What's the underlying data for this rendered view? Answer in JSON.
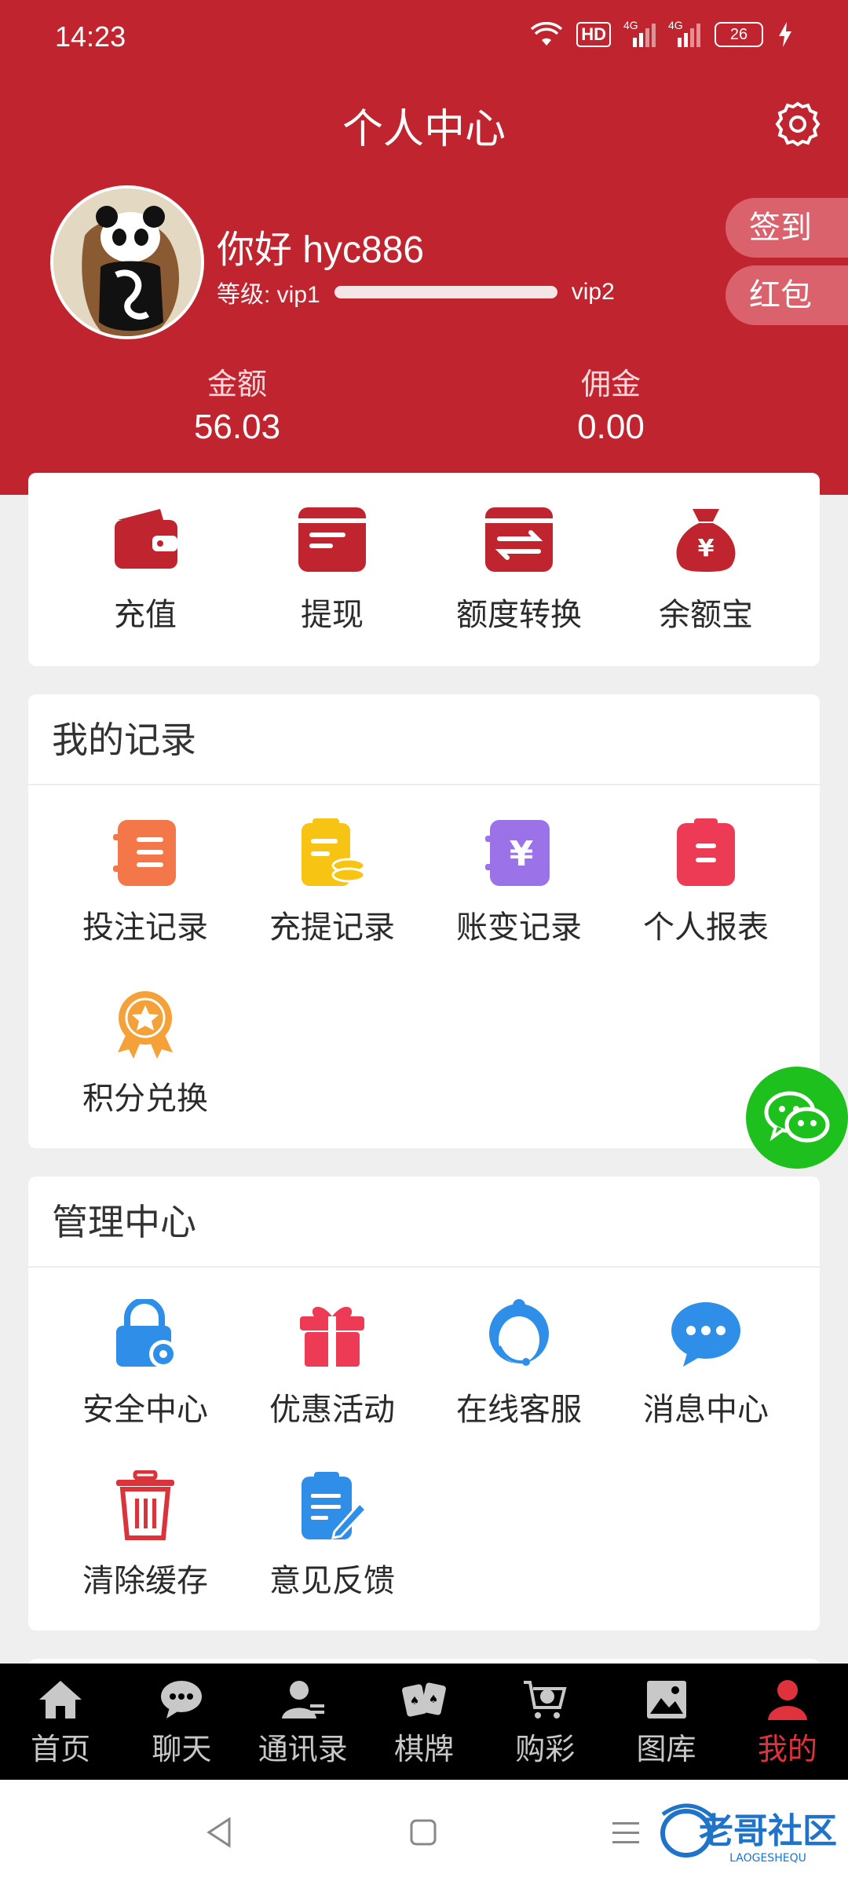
{
  "status_bar": {
    "time": "14:23",
    "hd": "HD",
    "net1": "4G",
    "net2": "4G",
    "battery": "26"
  },
  "header": {
    "title": "个人中心"
  },
  "profile": {
    "greeting": "你好 hyc886",
    "level_label": "等级: vip1",
    "next_level": "vip2",
    "level_progress": 0.0
  },
  "side_buttons": {
    "checkin": "签到",
    "redpacket": "红包"
  },
  "stats": {
    "balance_label": "金额",
    "balance_value": "56.03",
    "commission_label": "佣金",
    "commission_value": "0.00"
  },
  "quick_actions": [
    {
      "label": "充值",
      "icon": "wallet-icon"
    },
    {
      "label": "提现",
      "icon": "card-icon"
    },
    {
      "label": "额度转换",
      "icon": "transfer-icon"
    },
    {
      "label": "余额宝",
      "icon": "money-bag-icon"
    }
  ],
  "records": {
    "title": "我的记录",
    "items": [
      {
        "label": "投注记录",
        "icon": "bet-record-icon"
      },
      {
        "label": "充提记录",
        "icon": "deposit-record-icon"
      },
      {
        "label": "账变记录",
        "icon": "account-change-icon"
      },
      {
        "label": "个人报表",
        "icon": "report-icon"
      },
      {
        "label": "积分兑换",
        "icon": "points-medal-icon"
      }
    ]
  },
  "management": {
    "title": "管理中心",
    "items": [
      {
        "label": "安全中心",
        "icon": "lock-gear-icon"
      },
      {
        "label": "优惠活动",
        "icon": "gift-icon"
      },
      {
        "label": "在线客服",
        "icon": "customer-service-icon"
      },
      {
        "label": "消息中心",
        "icon": "chat-bubble-icon"
      },
      {
        "label": "清除缓存",
        "icon": "trash-icon"
      },
      {
        "label": "意见反馈",
        "icon": "feedback-icon"
      }
    ]
  },
  "tabbar": [
    {
      "label": "首页",
      "icon": "home-icon",
      "active": false
    },
    {
      "label": "聊天",
      "icon": "chat-icon",
      "active": false
    },
    {
      "label": "通讯录",
      "icon": "contacts-icon",
      "active": false
    },
    {
      "label": "棋牌",
      "icon": "cards-icon",
      "active": false
    },
    {
      "label": "购彩",
      "icon": "cart-icon",
      "active": false
    },
    {
      "label": "图库",
      "icon": "gallery-icon",
      "active": false
    },
    {
      "label": "我的",
      "icon": "profile-icon",
      "active": true
    }
  ],
  "watermark": {
    "text": "老哥社区",
    "sub": "LAOGESHEQU"
  },
  "colors": {
    "brand_red": "#c0242f",
    "tab_active": "#e0323c",
    "wechat_green": "#1ec01e"
  }
}
